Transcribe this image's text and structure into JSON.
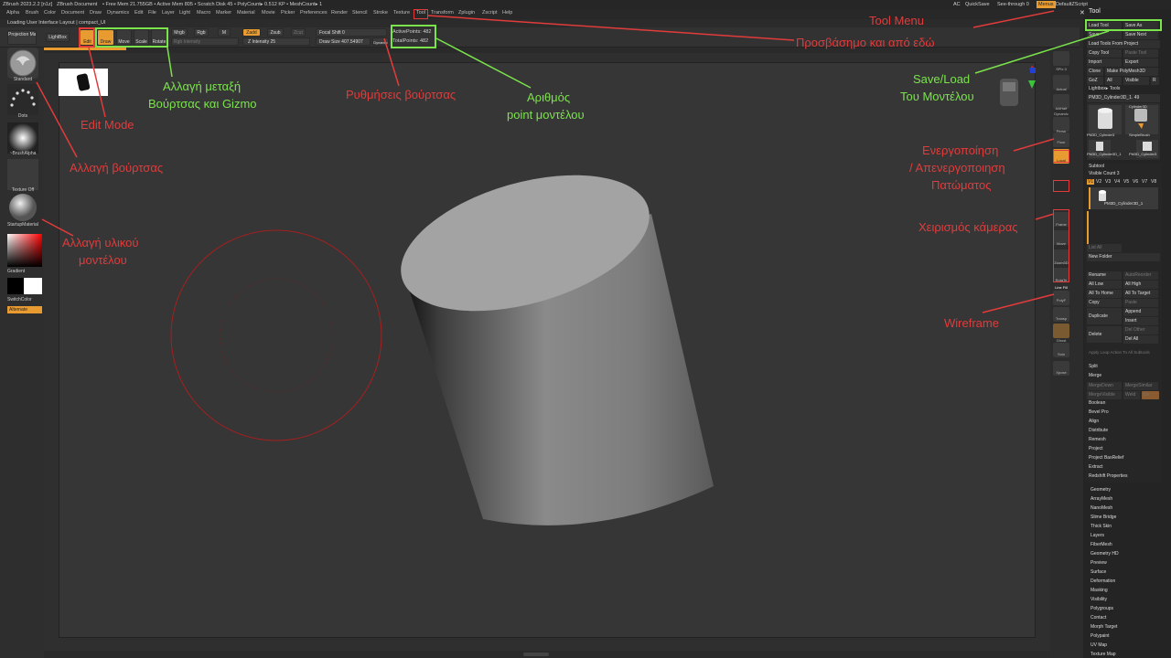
{
  "titlebar": {
    "app": "ZBrush 2023.2.2 [n1z]",
    "doc": "ZBrush Document",
    "stats": "• Free Mem 21.755GB • Active Mem 805 • Scratch Disk 45 • PolyCount▸ 0.512 KP • MeshCount▸ 1",
    "ac": "AC",
    "quicksave": "QuickSave",
    "seethrough": "See-through  0",
    "menus": "Menus",
    "defaultzscript": "DefaultZScript"
  },
  "menubar": [
    "Alpha",
    "Brush",
    "Color",
    "Document",
    "Draw",
    "Dynamics",
    "Edit",
    "File",
    "Layer",
    "Light",
    "Macro",
    "Marker",
    "Material",
    "Movie",
    "Picker",
    "Preferences",
    "Render",
    "Stencil",
    "Stroke",
    "Texture",
    "Tool",
    "Transform",
    "Zplugin",
    "Zscript",
    "Help"
  ],
  "layout_text": "Loading User Interface Layout | compact_UI",
  "toolbar": {
    "projection": "Projection Master",
    "lightbox": "LightBox",
    "edit": "Edit",
    "draw": "Draw",
    "move": "Move",
    "scale": "Scale",
    "rotate": "Rotate",
    "mrgb": "Mrgb",
    "rgb": "Rgb",
    "m": "M",
    "zadd": "Zadd",
    "zsub": "Zsub",
    "zcut": "Zcut",
    "rgb_intensity": "Rgb Intensity",
    "z_intensity": "Z Intensity 25",
    "focal_shift": "Focal Shift 0",
    "draw_size": "Draw Size 407.54907",
    "dynamic": "Dynamic",
    "active_points": "ActivePoints: 482",
    "total_points": "TotalPoints: 482"
  },
  "leftshelf": {
    "brush": "Standard",
    "dots": "Dots",
    "alpha": "~BrushAlpha",
    "texture": "Texture Off",
    "material": "StartupMaterial",
    "gradient": "Gradient",
    "switchcolor": "SwitchColor",
    "alternate": "Alternate"
  },
  "rightshelf": [
    "SPix 3",
    "Actual",
    "AAHalf",
    "Dynamic",
    "Persp",
    "Floor",
    "Local",
    "Frame",
    "Move",
    "Zoom3D",
    "RotaTe",
    "Line Fill",
    "PolyF",
    "Transp",
    "Ghost",
    "Solo",
    "Xpose"
  ],
  "toolpanel": {
    "title": "Tool",
    "load_tool": "Load Tool",
    "save_as": "Save As",
    "save": "Save",
    "save_next": "Save Next",
    "load_from_project": "Load Tools From Project",
    "copy_tool": "Copy Tool",
    "paste_tool": "Paste Tool",
    "import": "Import",
    "export": "Export",
    "clone": "Clone",
    "make_polymesh": "Make PolyMesh3D",
    "goz": "GoZ",
    "all": "All",
    "visible": "Visible",
    "r": "R",
    "lightbox_tools": "Lightbox▸ Tools",
    "current_tool": "PM3D_Cylinder3D_1. 49",
    "thumbs": [
      "PM3D_Cylinder3",
      "Cylinder3D",
      "SimpleBrush",
      "PM3D_Cylinder3D_1",
      "PM3D_Cylinder3"
    ],
    "subtool": "Subtool",
    "visible_count": "Visible Count 3",
    "v_labels": [
      "V1",
      "V2",
      "V3",
      "V4",
      "V5",
      "V6",
      "V7",
      "V8"
    ],
    "subtool_item": "PM3D_Cylinder3D_1",
    "list_all": "List All",
    "new_folder": "New Folder",
    "rename": "Rename",
    "autoreorder": "AutoReorder",
    "all_low": "All Low",
    "all_high": "All High",
    "all_to_home": "All To Home",
    "all_to_target": "All To Target",
    "copy": "Copy",
    "paste": "Paste",
    "duplicate": "Duplicate",
    "append": "Append",
    "insert": "Insert",
    "delete": "Delete",
    "del_other": "Del Other",
    "del_all": "Del All",
    "apply_loop": "Apply Loop Action To All Subtools",
    "split": "Split",
    "merge": "Merge",
    "mergedown": "MergeDown",
    "mergesimilar": "MergeSimilar",
    "mergevisible": "MergeVisible",
    "weld": "Weld",
    "uv": "Uv",
    "boolean": "Boolean",
    "bevel_pro": "Bevel Pro",
    "align": "Align",
    "distribute": "Distribute",
    "remesh": "Remesh",
    "project": "Project",
    "project_basrelief": "Project BasRelief",
    "extract": "Extract",
    "redshift": "Redshift Properties",
    "sections": [
      "Geometry",
      "ArrayMesh",
      "NanoMesh",
      "Slime Bridge",
      "Thick Skin",
      "Layers",
      "FiberMesh",
      "Geometry HD",
      "Preview",
      "Surface",
      "Deformation",
      "Masking",
      "Visibility",
      "Polygroups",
      "Contact",
      "Morph Target",
      "Polypaint",
      "UV Map",
      "Texture Map"
    ]
  },
  "annotations": {
    "tool_menu": "Tool Menu",
    "tool_menu_sub": "Προσβάσημο και από εδώ",
    "save_load_1": "Save/Load",
    "save_load_2": "Του Μοντέλου",
    "brush_gizmo_1": "Αλλαγή μεταξή",
    "brush_gizmo_2": "Βούρτσας και Gizmo",
    "edit_mode": "Edit Mode",
    "brush_settings": "Ρυθμήσεις βούρτσας",
    "points_1": "Αριθμός",
    "points_2": "point μοντέλου",
    "change_brush": "Αλλαγή βούρτσας",
    "change_material_1": "Αλλαγή υλικού",
    "change_material_2": "μοντέλου",
    "floor_1": "Ενεργοποίηση",
    "floor_2": "/ Απενεργοποιηση",
    "floor_3": "Πατώματος",
    "camera": "Χειρισμός κάμερας",
    "wireframe": "Wireframe"
  },
  "colors": {
    "accent_orange": "#e89b30",
    "annotation_red": "#e23b3b",
    "annotation_green": "#7be34c"
  }
}
